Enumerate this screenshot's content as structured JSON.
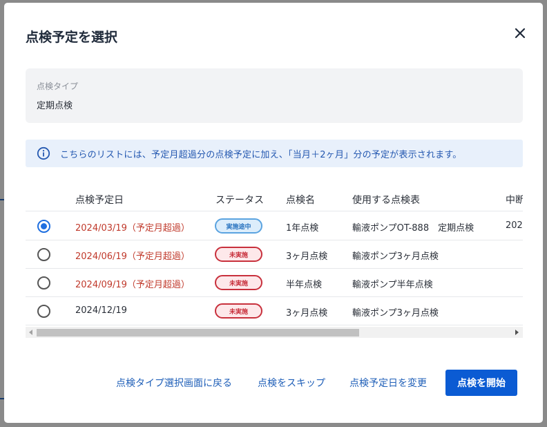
{
  "dialog": {
    "title": "点検予定を選択",
    "close_icon": "close-icon"
  },
  "inspection_type": {
    "label": "点検タイプ",
    "value": "定期点検"
  },
  "info": {
    "icon": "info-icon",
    "text": "こちらのリストには、予定月超過分の点検予定に加え、「当月＋2ヶ月」分の予定が表示されます。"
  },
  "table": {
    "headers": {
      "date": "点検予定日",
      "status": "ステータス",
      "name": "点検名",
      "sheet": "使用する点検表",
      "interrupted": "中断"
    },
    "rows": [
      {
        "selected": true,
        "date": "2024/03/19（予定月超過）",
        "overdue": true,
        "status": "実施途中",
        "status_kind": "progress",
        "name": "1年点検",
        "sheet": "輸液ポンプOT-888　定期点検",
        "interrupted": "202"
      },
      {
        "selected": false,
        "date": "2024/06/19（予定月超過）",
        "overdue": true,
        "status": "未実施",
        "status_kind": "pending",
        "name": "3ヶ月点検",
        "sheet": "輸液ポンプ3ヶ月点検",
        "interrupted": ""
      },
      {
        "selected": false,
        "date": "2024/09/19（予定月超過）",
        "overdue": true,
        "status": "未実施",
        "status_kind": "pending",
        "name": "半年点検",
        "sheet": "輸液ポンプ半年点検",
        "interrupted": ""
      },
      {
        "selected": false,
        "date": "2024/12/19",
        "overdue": false,
        "status": "未実施",
        "status_kind": "pending",
        "name": "3ヶ月点検",
        "sheet": "輸液ポンプ3ヶ月点検",
        "interrupted": ""
      }
    ]
  },
  "footer": {
    "back_label": "点検タイプ選択画面に戻る",
    "skip_label": "点検をスキップ",
    "change_date_label": "点検予定日を変更",
    "start_label": "点検を開始"
  },
  "colors": {
    "primary": "#0b5bd3",
    "overdue_text": "#c0392b",
    "info_bg": "#e8f0fb",
    "badge_progress": "#5aa3e0",
    "badge_pending": "#c8303c"
  }
}
